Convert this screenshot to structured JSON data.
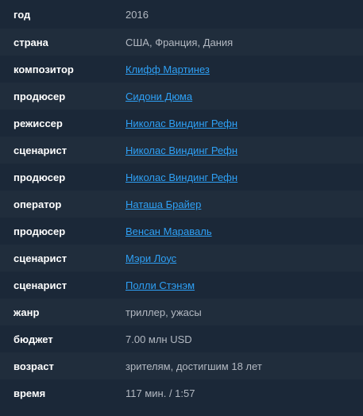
{
  "rows": [
    {
      "label": "год",
      "value": "2016",
      "link": false
    },
    {
      "label": "страна",
      "value": "США, Франция, Дания",
      "link": false
    },
    {
      "label": "композитор",
      "value": "Клифф Мартинез",
      "link": true
    },
    {
      "label": "продюсер",
      "value": "Сидони Дюма",
      "link": true
    },
    {
      "label": "режиссер",
      "value": "Николас Виндинг Рефн",
      "link": true
    },
    {
      "label": "сценарист",
      "value": "Николас Виндинг Рефн",
      "link": true
    },
    {
      "label": "продюсер",
      "value": "Николас Виндинг Рефн",
      "link": true
    },
    {
      "label": "оператор",
      "value": "Наташа Брайер",
      "link": true
    },
    {
      "label": "продюсер",
      "value": "Венсан Мараваль",
      "link": true
    },
    {
      "label": "сценарист",
      "value": "Мэри Лоус",
      "link": true
    },
    {
      "label": "сценарист",
      "value": "Полли Стэнэм",
      "link": true
    },
    {
      "label": "жанр",
      "value": "триллер, ужасы",
      "link": false
    },
    {
      "label": "бюджет",
      "value": "7.00 млн USD",
      "link": false
    },
    {
      "label": "возраст",
      "value": "зрителям, достигшим 18 лет",
      "link": false
    },
    {
      "label": "время",
      "value": "117 мин. / 1:57",
      "link": false
    }
  ],
  "colors": {
    "background": "#1b2838",
    "row_alt": "#202d3c",
    "label": "#ffffff",
    "text": "#b3b9c2",
    "link": "#2ea0f5"
  }
}
